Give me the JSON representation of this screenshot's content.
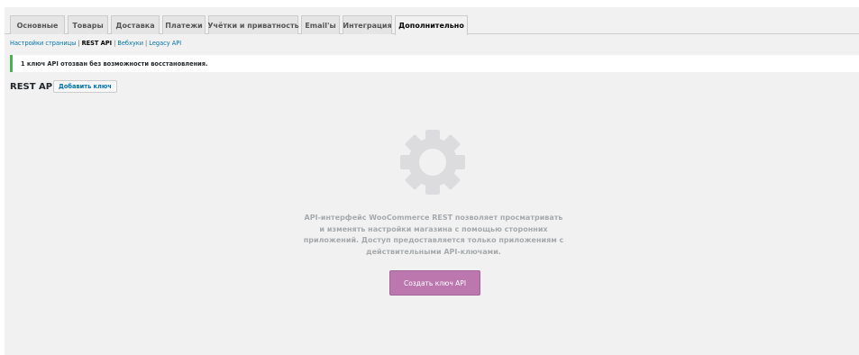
{
  "tabs": [
    {
      "label": "Основные"
    },
    {
      "label": "Товары"
    },
    {
      "label": "Доставка"
    },
    {
      "label": "Платежи"
    },
    {
      "label": "Учётки и приватность"
    },
    {
      "label": "Email'ы"
    },
    {
      "label": "Интеграция"
    },
    {
      "label": "Дополнительно"
    }
  ],
  "active_tab": "Дополнительно",
  "subnav": {
    "items": [
      {
        "label": "Настройки страницы"
      },
      {
        "label": "REST API"
      },
      {
        "label": "Вебхуки"
      },
      {
        "label": "Legacy API"
      }
    ],
    "separator": "|",
    "current": "REST API"
  },
  "notice": {
    "text": "1 ключ API отозван без возможности восстановления.",
    "color": "#46b450"
  },
  "page": {
    "title": "REST API",
    "add_key_label": "Добавить ключ"
  },
  "blankslate": {
    "icon": "gear-icon",
    "message": "API-интерфейс WooCommerce REST позволяет просматривать и изменять настройки магазина с помощью сторонних приложений. Доступ предоставляется только приложениям с действительными API-ключами.",
    "button_label": "Создать ключ API",
    "button_color": "#bb77ae"
  }
}
